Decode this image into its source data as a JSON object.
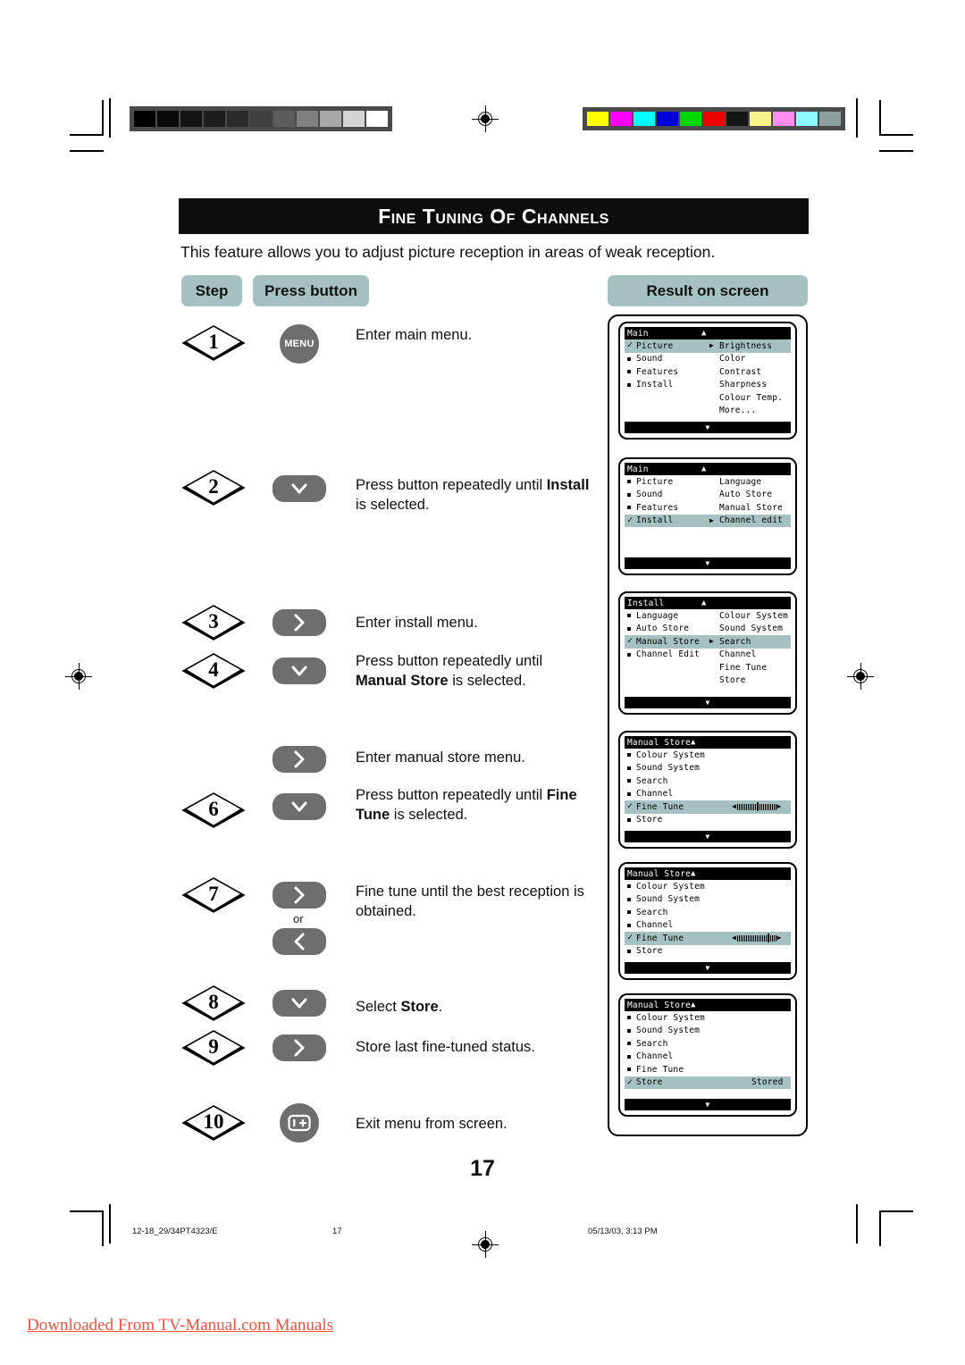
{
  "page": {
    "title": "Fine Tuning of Channels",
    "intro": "This feature allows you to adjust picture reception in areas of weak reception.",
    "page_number": "17"
  },
  "headers": {
    "step": "Step",
    "press_button": "Press button",
    "result_on_screen": "Result on screen"
  },
  "steps": [
    {
      "number": "1",
      "button": {
        "type": "round",
        "icon": "menu-button",
        "label": "MENU"
      },
      "text_parts": [
        {
          "t": "Enter main menu.",
          "bold": false
        }
      ]
    },
    {
      "number": "2",
      "button": {
        "type": "pill",
        "icon": "chevron-down-icon",
        "label": ""
      },
      "text_parts": [
        {
          "t": "Press button repeatedly until ",
          "bold": false
        },
        {
          "t": "Install",
          "bold": true
        },
        {
          "t": " is selected.",
          "bold": false
        }
      ]
    },
    {
      "number": "3",
      "button": {
        "type": "pill",
        "icon": "chevron-right-icon",
        "label": ""
      },
      "text_parts": [
        {
          "t": "Enter install menu.",
          "bold": false
        }
      ]
    },
    {
      "number": "4",
      "button": {
        "type": "pill",
        "icon": "chevron-down-icon",
        "label": ""
      },
      "text_parts": [
        {
          "t": "Press button repeatedly until ",
          "bold": false
        },
        {
          "t": "Manual Store",
          "bold": true
        },
        {
          "t": " is selected.",
          "bold": false
        }
      ]
    },
    {
      "number": "",
      "button": {
        "type": "pill",
        "icon": "chevron-right-icon",
        "label": ""
      },
      "text_parts": [
        {
          "t": "Enter manual store menu.",
          "bold": false
        }
      ]
    },
    {
      "number": "6",
      "button": {
        "type": "pill",
        "icon": "chevron-down-icon",
        "label": ""
      },
      "text_parts": [
        {
          "t": "Press button repeatedly until ",
          "bold": false
        },
        {
          "t": "Fine Tune",
          "bold": true
        },
        {
          "t": " is selected.",
          "bold": false
        }
      ]
    },
    {
      "number": "7",
      "button": {
        "type": "pill-pair",
        "icon": "chevron-right-icon",
        "icon2": "chevron-left-icon",
        "or_label": "or"
      },
      "text_parts": [
        {
          "t": "Fine tune until the best reception is obtained.",
          "bold": false
        }
      ]
    },
    {
      "number": "8",
      "button": {
        "type": "pill",
        "icon": "chevron-down-icon",
        "label": ""
      },
      "text_parts": [
        {
          "t": "Select ",
          "bold": false
        },
        {
          "t": "Store",
          "bold": true
        },
        {
          "t": ".",
          "bold": false
        }
      ]
    },
    {
      "number": "9",
      "button": {
        "type": "pill",
        "icon": "chevron-right-icon",
        "label": ""
      },
      "text_parts": [
        {
          "t": "Store last fine-tuned status.",
          "bold": false
        }
      ]
    },
    {
      "number": "10",
      "button": {
        "type": "round",
        "icon": "info-plus-icon",
        "label": ""
      },
      "text_parts": [
        {
          "t": "Exit menu from screen.",
          "bold": false
        }
      ]
    }
  ],
  "screens": [
    {
      "id": "screen-main-picture",
      "title": "Main",
      "title_arrow": "▲",
      "rows": [
        {
          "marker": "check",
          "left": "Picture",
          "arrow": "▶",
          "right": "Brightness",
          "selected": true
        },
        {
          "marker": "bullet",
          "left": "Sound",
          "arrow": "",
          "right": "Color",
          "selected": false
        },
        {
          "marker": "bullet",
          "left": "Features",
          "arrow": "",
          "right": "Contrast",
          "selected": false
        },
        {
          "marker": "bullet",
          "left": "Install",
          "arrow": "",
          "right": "Sharpness",
          "selected": false
        },
        {
          "marker": "none",
          "left": "",
          "arrow": "",
          "right": "Colour Temp.",
          "selected": false
        },
        {
          "marker": "none",
          "left": "",
          "arrow": "",
          "right": "More...",
          "selected": false
        }
      ],
      "footer_arrow": "▼"
    },
    {
      "id": "screen-main-install",
      "title": "Main",
      "title_arrow": "▲",
      "rows": [
        {
          "marker": "bullet",
          "left": "Picture",
          "arrow": "",
          "right": "Language",
          "selected": false
        },
        {
          "marker": "bullet",
          "left": "Sound",
          "arrow": "",
          "right": "Auto Store",
          "selected": false
        },
        {
          "marker": "bullet",
          "left": "Features",
          "arrow": "",
          "right": "Manual Store",
          "selected": false
        },
        {
          "marker": "check",
          "left": "Install",
          "arrow": "▶",
          "right": "Channel edit",
          "selected": true
        }
      ],
      "footer_arrow": "▼"
    },
    {
      "id": "screen-install-manualstore",
      "title": "Install",
      "title_arrow": "▲",
      "rows": [
        {
          "marker": "bullet",
          "left": "Language",
          "arrow": "",
          "right": "Colour System",
          "selected": false
        },
        {
          "marker": "bullet",
          "left": "Auto Store",
          "arrow": "",
          "right": "Sound System",
          "selected": false
        },
        {
          "marker": "check",
          "left": "Manual Store",
          "arrow": "▶",
          "right": "Search",
          "selected": true
        },
        {
          "marker": "bullet",
          "left": "Channel Edit",
          "arrow": "",
          "right": "Channel",
          "selected": false
        },
        {
          "marker": "none",
          "left": "",
          "arrow": "",
          "right": "Fine Tune",
          "selected": false
        },
        {
          "marker": "none",
          "left": "",
          "arrow": "",
          "right": "Store",
          "selected": false
        }
      ],
      "footer_arrow": "▼"
    },
    {
      "id": "screen-manualstore-finetune-center",
      "title": "Manual Store",
      "title_arrow": "▲",
      "title_tight": true,
      "rows": [
        {
          "marker": "bullet",
          "left": "Colour System",
          "selected": false
        },
        {
          "marker": "bullet",
          "left": "Sound System",
          "selected": false
        },
        {
          "marker": "bullet",
          "left": "Search",
          "selected": false
        },
        {
          "marker": "bullet",
          "left": "Channel",
          "selected": false
        },
        {
          "marker": "check",
          "left": "Fine Tune",
          "selected": true,
          "slider": {
            "position": 11,
            "ticks": 22
          }
        },
        {
          "marker": "bullet",
          "left": "Store",
          "selected": false
        }
      ],
      "footer_arrow": "▼"
    },
    {
      "id": "screen-manualstore-finetune-right",
      "title": "Manual Store",
      "title_arrow": "▲",
      "title_tight": true,
      "rows": [
        {
          "marker": "bullet",
          "left": "Colour System",
          "selected": false
        },
        {
          "marker": "bullet",
          "left": "Sound System",
          "selected": false
        },
        {
          "marker": "bullet",
          "left": "Search",
          "selected": false
        },
        {
          "marker": "bullet",
          "left": "Channel",
          "selected": false
        },
        {
          "marker": "check",
          "left": "Fine Tune",
          "selected": true,
          "slider": {
            "position": 17,
            "ticks": 22
          }
        },
        {
          "marker": "bullet",
          "left": "Store",
          "selected": false
        }
      ],
      "footer_arrow": "▼"
    },
    {
      "id": "screen-manualstore-stored",
      "title": "Manual Store",
      "title_arrow": "▲",
      "title_tight": true,
      "rows": [
        {
          "marker": "bullet",
          "left": "Colour System",
          "selected": false
        },
        {
          "marker": "bullet",
          "left": "Sound System",
          "selected": false
        },
        {
          "marker": "bullet",
          "left": "Search",
          "selected": false
        },
        {
          "marker": "bullet",
          "left": "Channel",
          "selected": false
        },
        {
          "marker": "bullet",
          "left": "Fine Tune",
          "selected": false
        },
        {
          "marker": "check",
          "left": "Store",
          "right": "Stored",
          "selected": true
        }
      ],
      "footer_arrow": "▼"
    }
  ],
  "footer": {
    "doc_code": "12-18_29/34PT4323/E",
    "page": "17",
    "timestamp": "05/13/03, 3:13 PM"
  },
  "watermark": "Downloaded From TV-Manual.com Manuals",
  "calibration": {
    "grayscale": [
      "#000000",
      "#090909",
      "#141414",
      "#1e1e1e",
      "#2b2b2b",
      "#3f3f3f",
      "#5c5c5c",
      "#808080",
      "#a8a8a8",
      "#d4d4d4",
      "#ffffff"
    ],
    "colors": [
      "#ffff00",
      "#ff00ff",
      "#00ffff",
      "#0000d8",
      "#00d800",
      "#ee0000",
      "#161616",
      "#fbf18c",
      "#ff8cf0",
      "#8cfaff",
      "#8ca0a0"
    ]
  },
  "colors": {
    "accent_pill": "#a6c1c1",
    "button_gray": "#6e6e6e",
    "title_bar": "#0d0d0d",
    "watermark_red": "#f4503c"
  }
}
